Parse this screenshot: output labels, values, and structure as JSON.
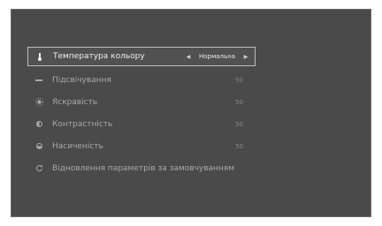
{
  "menu": {
    "items": [
      {
        "label": "Температура кольору",
        "icon": "thermometer-icon",
        "selected": true
      },
      {
        "label": "Підсвічування",
        "icon": "backlight-icon",
        "value": "50"
      },
      {
        "label": "Яскравість",
        "icon": "brightness-icon",
        "value": "50"
      },
      {
        "label": "Контрастність",
        "icon": "contrast-icon",
        "value": "50"
      },
      {
        "label": "Насиченість",
        "icon": "saturation-icon",
        "value": "50"
      },
      {
        "label": "Відновлення параметрів за замовчуванням",
        "icon": "reset-icon"
      }
    ],
    "color_temp": {
      "left_arrow": "◀",
      "option": "Нормальна",
      "right_arrow": "▶"
    }
  },
  "colors": {
    "background": "#4a4a4a",
    "selected_border": "#bdbdbd",
    "text_active": "#f0f0f0",
    "text_dim": "#a9a9a9"
  }
}
